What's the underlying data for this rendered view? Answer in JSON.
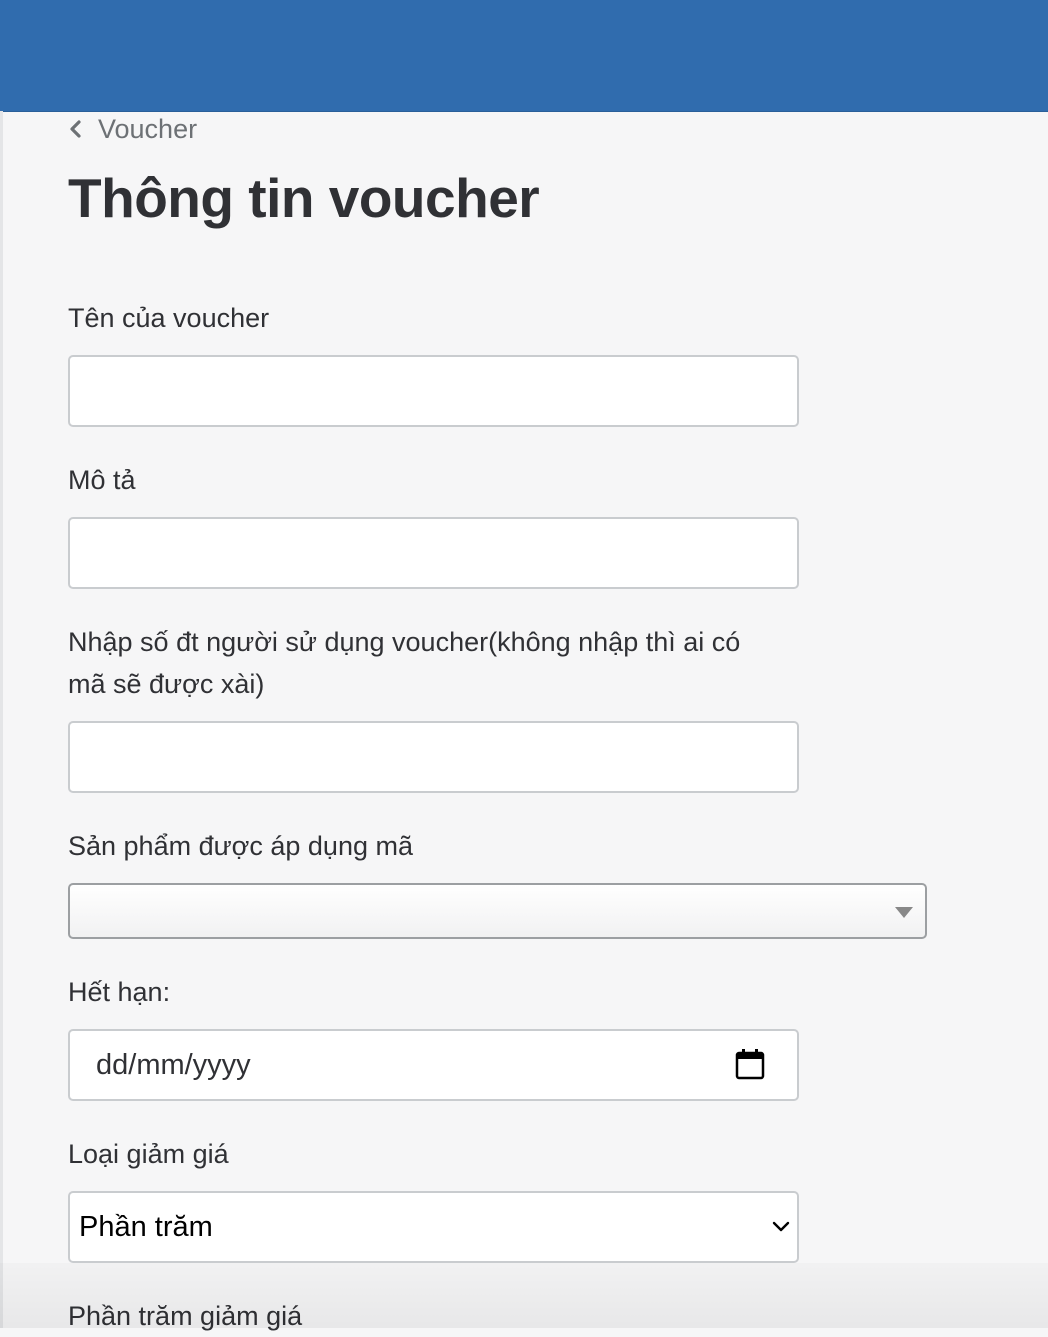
{
  "header": {
    "brand_color": "#306cae"
  },
  "breadcrumb": {
    "icon": "chevron-left-icon",
    "label": "Voucher"
  },
  "page": {
    "title": "Thông tin voucher"
  },
  "form": {
    "name_label": "Tên của voucher",
    "name_value": "",
    "description_label": "Mô tả",
    "description_value": "",
    "phone_label_line1": "Nhập số đt người sử dụng voucher(không nhập thì ai có",
    "phone_label_line2": "mã sẽ được xài)",
    "phone_value": "",
    "products_label": "Sản phẩm được áp dụng mã",
    "products_value": "",
    "expiry_label": "Hết hạn:",
    "expiry_placeholder": "dd/mm/yyyy",
    "expiry_icon": "calendar-icon",
    "discount_type_label": "Loại giảm giá",
    "discount_type_value": "Phần trăm",
    "discount_percent_label": "Phần trăm giảm giá"
  }
}
